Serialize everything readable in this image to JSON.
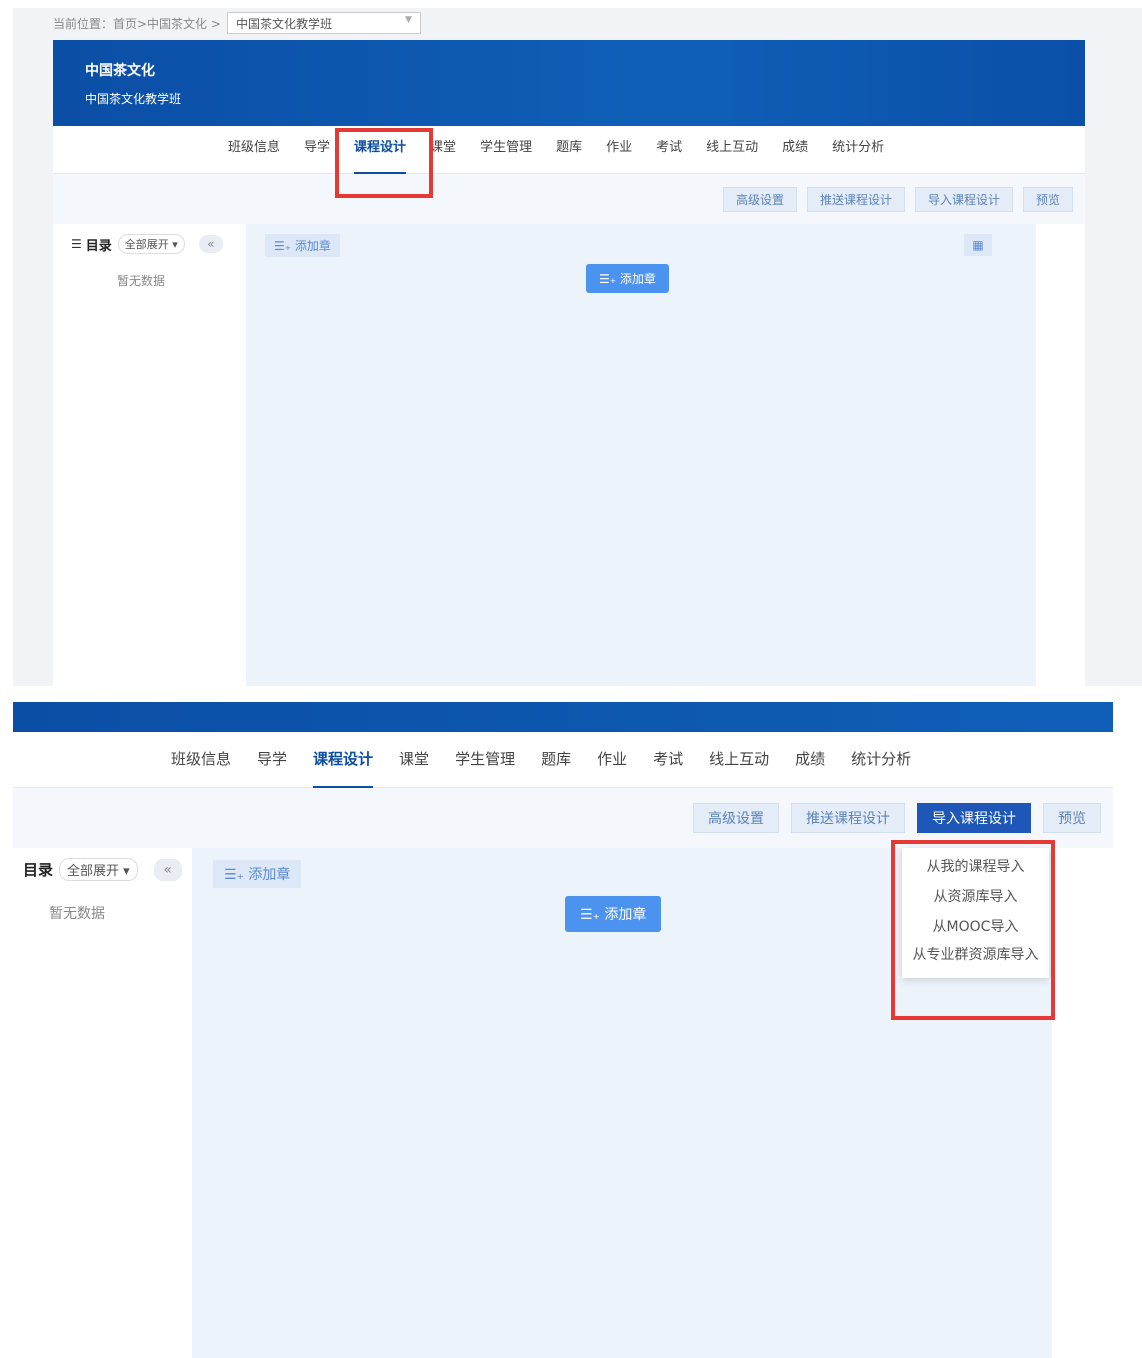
{
  "breadcrumb": {
    "prefix": "当前位置：首页>中国茶文化 >",
    "select_value": "中国茶文化教学班"
  },
  "hero": {
    "title": "中国茶文化",
    "subtitle": "中国茶文化教学班"
  },
  "nav": {
    "tabs": [
      "班级信息",
      "导学",
      "课程设计",
      "课堂",
      "学生管理",
      "题库",
      "作业",
      "考试",
      "线上互动",
      "成绩",
      "统计分析"
    ],
    "active": "课程设计"
  },
  "toolbar": {
    "advanced": "高级设置",
    "push": "推送课程设计",
    "import": "导入课程设计",
    "preview": "预览"
  },
  "sidebar": {
    "directory": "目录",
    "expand_all": "全部展开",
    "empty": "暂无数据"
  },
  "main": {
    "add_chapter": "添加章"
  },
  "import_menu": [
    "从我的课程导入",
    "从资源库导入",
    "从MOOC导入",
    "从专业群资源库导入"
  ],
  "colors": {
    "brand": "#0d4ea3",
    "highlight": "#e53935",
    "button_primary": "#4b93ee"
  },
  "icons": {
    "list": "list-icon",
    "collapse": "double-chevron-left-icon",
    "grid": "grid-icon",
    "add": "add-chapter-icon"
  }
}
